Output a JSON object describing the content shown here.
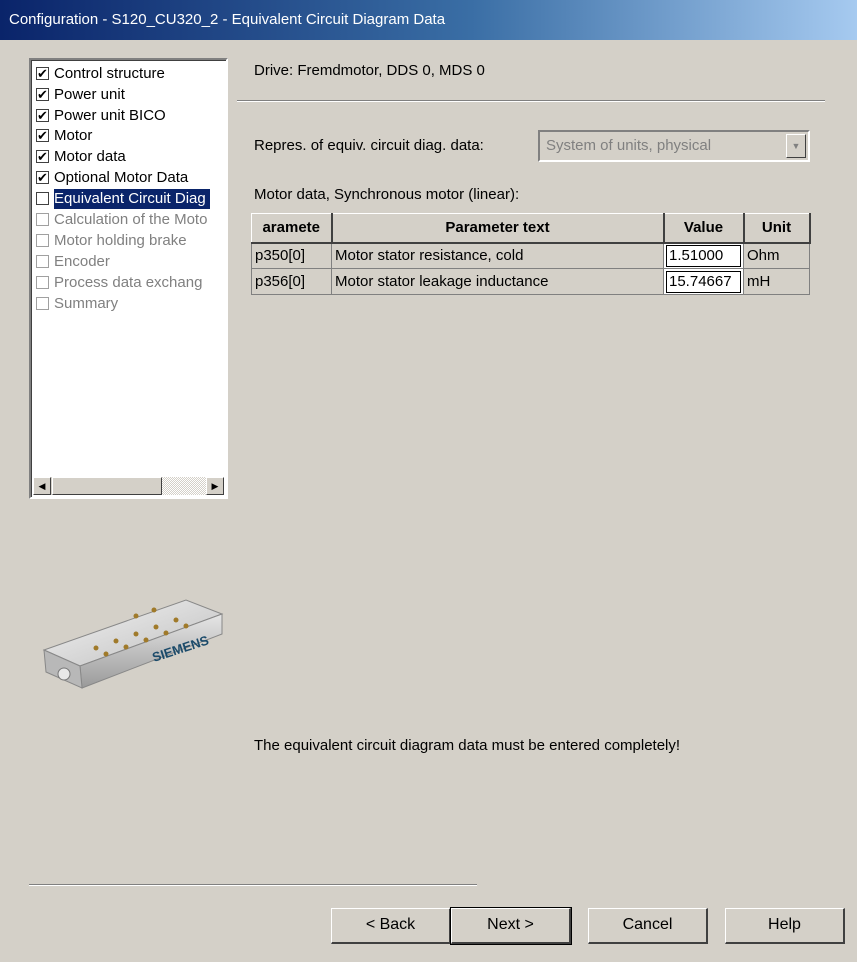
{
  "window": {
    "title": "Configuration - S120_CU320_2 - Equivalent Circuit Diagram Data"
  },
  "steps": [
    {
      "label": "Control structure",
      "checked": true,
      "state": "done"
    },
    {
      "label": "Power unit",
      "checked": true,
      "state": "done"
    },
    {
      "label": "Power unit BICO",
      "checked": true,
      "state": "done"
    },
    {
      "label": "Motor",
      "checked": true,
      "state": "done"
    },
    {
      "label": "Motor data",
      "checked": true,
      "state": "done"
    },
    {
      "label": "Optional Motor Data",
      "checked": true,
      "state": "done"
    },
    {
      "label": "Equivalent Circuit Diag",
      "checked": false,
      "state": "selected"
    },
    {
      "label": "Calculation of the Moto",
      "checked": false,
      "state": "pending"
    },
    {
      "label": "Motor holding brake",
      "checked": false,
      "state": "pending"
    },
    {
      "label": "Encoder",
      "checked": false,
      "state": "pending"
    },
    {
      "label": "Process data exchang",
      "checked": false,
      "state": "pending"
    },
    {
      "label": "Summary",
      "checked": false,
      "state": "pending"
    }
  ],
  "product_image": {
    "brand_text": "SIEMENS"
  },
  "main": {
    "drive_label": "Drive: Fremdmotor, DDS 0, MDS 0",
    "repres_label": "Repres. of equiv. circuit diag. data:",
    "repres_value": "System of units, physical",
    "table_caption": "Motor data, Synchronous motor (linear):",
    "table": {
      "headers": [
        "aramete",
        "Parameter text",
        "Value",
        "Unit"
      ],
      "rows": [
        {
          "param": "p350[0]",
          "text": "Motor stator resistance, cold",
          "value": "1.51000",
          "unit": "Ohm"
        },
        {
          "param": "p356[0]",
          "text": "Motor stator leakage inductance",
          "value": "15.74667",
          "unit": "mH"
        }
      ]
    },
    "notice": "The equivalent circuit diagram data must be entered completely!"
  },
  "buttons": {
    "back": "< Back",
    "next": "Next >",
    "cancel": "Cancel",
    "help": "Help"
  },
  "colors": {
    "selection": "#0a246a",
    "dialog_bg": "#d4d0c8"
  }
}
